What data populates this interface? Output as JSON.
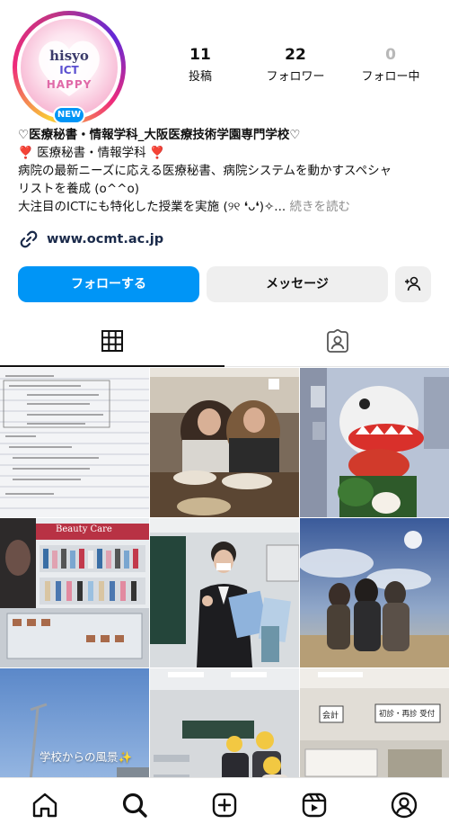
{
  "profile": {
    "avatar_text": {
      "line1": "hisyo",
      "line2": "ICT",
      "line3": "HAPPY"
    },
    "new_badge": "NEW",
    "stats": [
      {
        "value": "11",
        "label": "投稿"
      },
      {
        "value": "22",
        "label": "フォロワー"
      },
      {
        "value": "0",
        "label": "フォロー中"
      }
    ],
    "bio": {
      "name": "♡医療秘書・情報学科_大阪医療技術学園専門学校♡",
      "line1": "❣️ 医療秘書・情報学科 ❣️",
      "line2": "病院の最新ニーズに応える医療秘書、病院システムを動かすスペシャ",
      "line3": "リストを養成 (o^^o)",
      "line4": "大注目のICTにも特化した授業を実施 (୨୧ ❛ᴗ❛)✧...",
      "more": " 続きを読む"
    },
    "link": "www.ocmt.ac.jp"
  },
  "actions": {
    "follow": "フォローする",
    "message": "メッセージ"
  },
  "tabs": [
    {
      "name": "grid-icon",
      "active": true
    },
    {
      "name": "tagged-icon",
      "active": false
    }
  ],
  "posts": [
    {
      "type": "notes"
    },
    {
      "type": "friends-restaurant"
    },
    {
      "type": "mascot-figure"
    },
    {
      "type": "beauty-care-store",
      "sign": "Beauty Care"
    },
    {
      "type": "student-classroom"
    },
    {
      "type": "friends-outdoor"
    },
    {
      "type": "sky-view",
      "caption": "学校からの風景✨"
    },
    {
      "type": "classroom-group"
    },
    {
      "type": "lab-room",
      "sign1": "会計",
      "sign2": "初診・再診 受付"
    }
  ],
  "nav": [
    "home-icon",
    "search-icon",
    "create-icon",
    "reels-icon",
    "profile-icon"
  ],
  "colors": {
    "accent": "#0095f6",
    "muted": "#8e8e8e",
    "button_bg": "#efefef"
  }
}
